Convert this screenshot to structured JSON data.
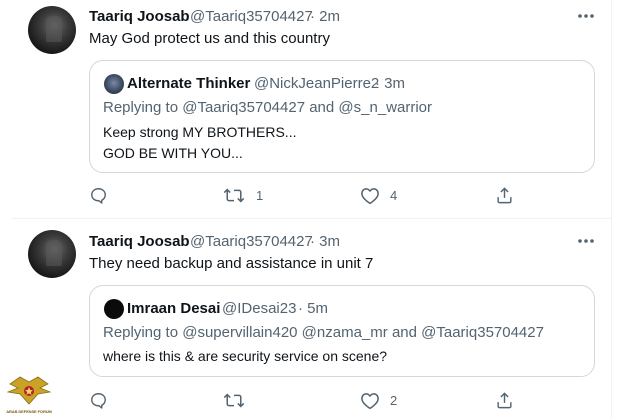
{
  "tweets": [
    {
      "author": "Taariq Joosab",
      "handle": "@Taariq35704427",
      "time": "· 2m",
      "text": "May God protect us and this country",
      "quote": {
        "author": "Alternate Thinker",
        "handle": "@NickJeanPierre2",
        "time": "· 3m",
        "replying_prefix": "Replying to",
        "replying_user1": "@Taariq35704427",
        "replying_and": "and",
        "replying_user2": "@s_n_warrior",
        "line1": "Keep strong MY BROTHERS...",
        "line2": "GOD BE WITH YOU..."
      },
      "retweets": "1",
      "likes": "4"
    },
    {
      "author": "Taariq Joosab",
      "handle": "@Taariq35704427",
      "time": "· 3m",
      "text": "They need backup and assistance in unit 7",
      "quote": {
        "author": "Imraan Desai",
        "handle": "@IDesai23",
        "time": "· 5m",
        "replying_prefix": "Replying to",
        "replying_users": "@supervillain420 @nzama_mr",
        "replying_and": "and",
        "replying_user3": "@Taariq35704427",
        "line1": "where is this & are security service on scene?"
      },
      "retweets": "",
      "likes": "2"
    }
  ],
  "watermark": "ARAB DEFENSE FORUM",
  "colors": {
    "text": "#0f1419",
    "muted": "#536471",
    "border": "#cfd9de",
    "divider": "#eff3f4"
  },
  "icons": [
    "more-icon",
    "reply-icon",
    "retweet-icon",
    "like-icon",
    "share-icon"
  ]
}
